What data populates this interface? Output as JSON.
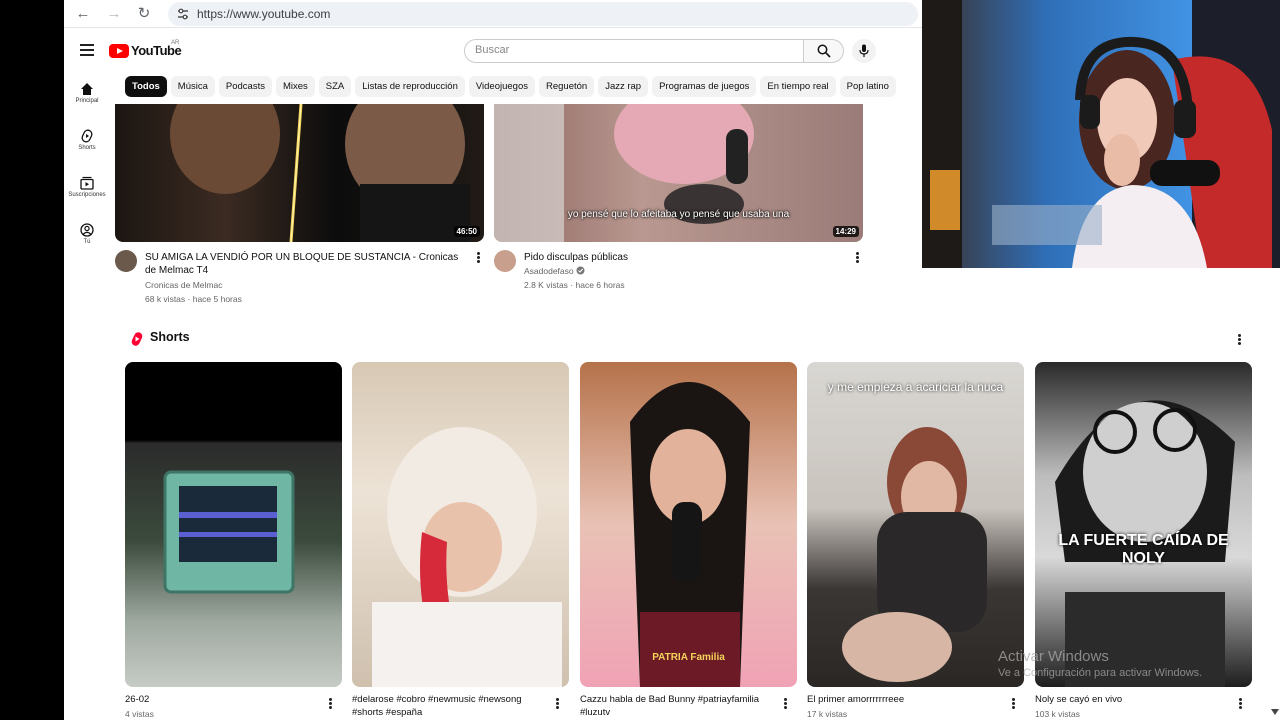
{
  "browser": {
    "url": "https://www.youtube.com"
  },
  "header": {
    "logo_text": "YouTube",
    "country_code": "AR",
    "search_placeholder": "Buscar"
  },
  "chips": [
    "Todos",
    "Música",
    "Podcasts",
    "Mixes",
    "SZA",
    "Listas de reproducción",
    "Videojuegos",
    "Reguetón",
    "Jazz rap",
    "Programas de juegos",
    "En tiempo real",
    "Pop latino"
  ],
  "rail": [
    {
      "label": "Principal",
      "icon": "home-icon"
    },
    {
      "label": "Shorts",
      "icon": "shorts-icon"
    },
    {
      "label": "Suscripciones",
      "icon": "subscriptions-icon"
    },
    {
      "label": "Tú",
      "icon": "you-icon"
    }
  ],
  "videos": [
    {
      "title": "SU AMIGA LA VENDIÓ POR UN BLOQUE DE SUSTANCIA - Cronicas de Melmac T4",
      "channel": "Cronicas de Melmac",
      "views": "68 k vistas",
      "age": "hace 5 horas",
      "duration": "46:50"
    },
    {
      "title": "Pido disculpas públicas",
      "channel": "Asadodefaso",
      "views": "2.8 K vistas",
      "age": "hace 6 horas",
      "duration": "14:29",
      "caption": "yo pensé que lo afeitaba yo pensé que usaba una"
    }
  ],
  "shorts": {
    "section_title": "Shorts",
    "items": [
      {
        "title": "26-02",
        "views": "4 vistas"
      },
      {
        "title": "#delarose #cobro #newmusic #newsong #shorts #españa",
        "views": ""
      },
      {
        "title": "Cazzu habla de Bad Bunny  #patriayfamilia #luzutv",
        "views": "",
        "overlay": "PATRIA Familia"
      },
      {
        "title": "El primer amorrrrrrreee",
        "views": "17 k vistas",
        "overlay": "y me empieza a acariciar la nuca"
      },
      {
        "title": "Noly se cayó en vivo",
        "views": "103 k vistas",
        "overlay": "LA FUERTE CAÍDA DE NOLY"
      }
    ]
  },
  "watermark": {
    "line1": "Activar Windows",
    "line2": "Ve a Configuración para activar Windows."
  },
  "colors": {
    "brand_red": "#ff0000",
    "chip_active": "#0f0f0f",
    "chip_bg": "#f2f2f2"
  }
}
